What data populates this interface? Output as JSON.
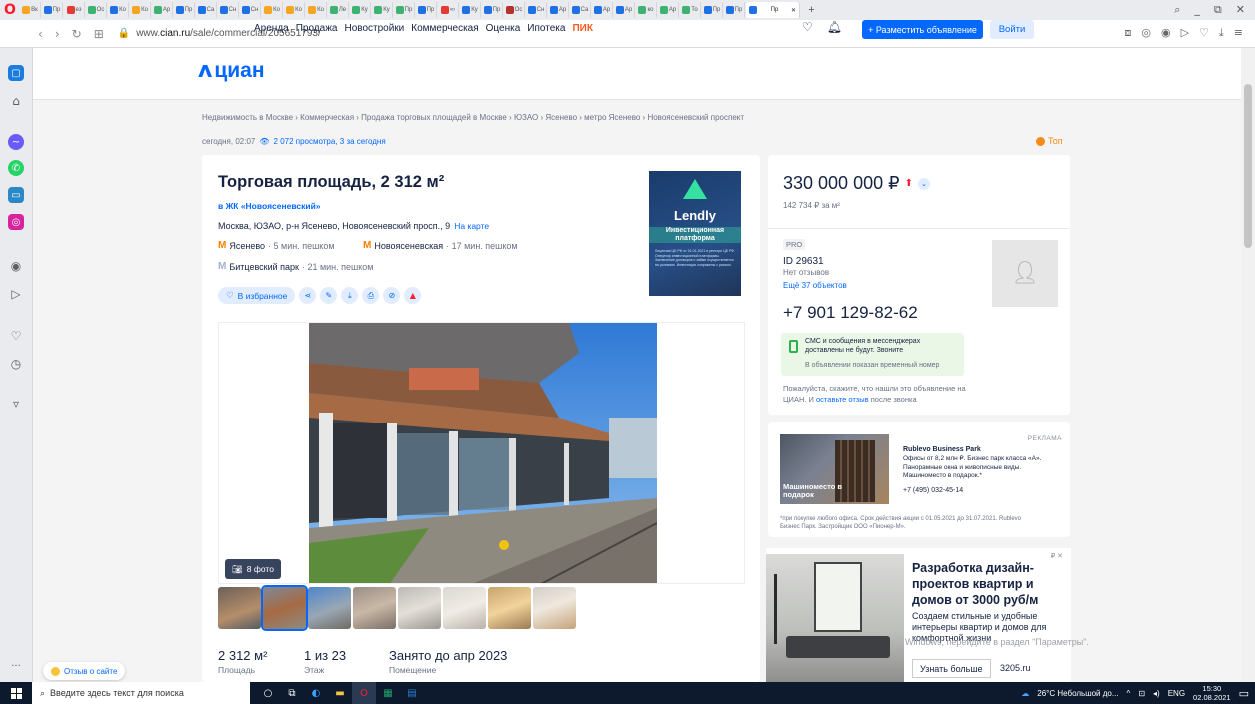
{
  "browser": {
    "url_prefix": "www.",
    "url_domain": "cian.ru",
    "url_path": "/sale/commercial/205651793/",
    "active_tab_label": "Пр",
    "tab_labels": [
      "Вк",
      "Пр",
      "ез",
      "Ос",
      "Ко",
      "Ко",
      "Ар",
      "Пр",
      "Са",
      "Сн",
      "Сн",
      "Ко",
      "Ко",
      "Ко",
      "Ле",
      "Ку",
      "Ку",
      "Пр",
      "Пр",
      "«›",
      "Ку",
      "Пр",
      "Ос",
      "Сн",
      "Ар",
      "Са",
      "Ар",
      "Ар",
      "ко",
      "Ар",
      "То",
      "Пр",
      "Пр"
    ],
    "tab_colors": [
      "#f5a623",
      "#1f6fe5",
      "#e53935",
      "#3cb371",
      "#1f6fe5",
      "#f5a623",
      "#3cb371",
      "#1f6fe5",
      "#1f6fe5",
      "#1f6fe5",
      "#1f6fe5",
      "#f5a623",
      "#f5a623",
      "#f5a623",
      "#3cb371",
      "#3cb371",
      "#3cb371",
      "#3cb371",
      "#1f6fe5",
      "#e53935",
      "#1f6fe5",
      "#1f6fe5",
      "#b7312c",
      "#1f6fe5",
      "#1f6fe5",
      "#1f6fe5",
      "#1f6fe5",
      "#1f6fe5",
      "#3cb371",
      "#3cb371",
      "#3cb371",
      "#1f6fe5",
      "#1f6fe5"
    ]
  },
  "site": {
    "logo": "циан",
    "nav": [
      "Аренда",
      "Продажа",
      "Новостройки",
      "Коммерческая",
      "Оценка",
      "Ипотека"
    ],
    "nav_pik": "ПИК",
    "post_button": "+ Разместить объявление",
    "login_button": "Войти"
  },
  "breadcrumbs": "Недвижимость в Москве  ›  Коммерческая  ›  Продажа торговых площадей в Москве  ›  ЮЗАО  ›  Ясенево  ›  метро Ясенево  ›  Новоясеневский проспект",
  "meta": {
    "date": "сегодня, 02:07",
    "views": "2 072 просмотра, 3 за сегодня",
    "top": "Топ"
  },
  "listing": {
    "title": "Торговая площадь, 2 312 м²",
    "complex": "в ЖК «Новоясеневский»",
    "address": "Москва, ЮЗАО, р-н Ясенево, Новоясеневский просп., 9",
    "map_link": "На карте",
    "metro": [
      {
        "name": "Ясенево",
        "walk": "· 5 мин. пешком"
      },
      {
        "name": "Новоясеневская",
        "walk": "· 17 мин. пешком"
      },
      {
        "name": "Битцевский парк",
        "walk": "· 21 мин. пешком"
      }
    ],
    "favorite_button": "В избранное",
    "photo_count": "8 фото",
    "facts": [
      {
        "value": "2 312 м²",
        "label": "Площадь"
      },
      {
        "value": "1 из 23",
        "label": "Этаж"
      },
      {
        "value": "Занято до апр 2023",
        "label": "Помещение"
      }
    ]
  },
  "ad_lendly": {
    "name": "Lendly",
    "tagline": "Инвестиционная платформа",
    "fine": "Лицензия ЦБ РФ от 01.01.2021 в реестре ЦБ РФ. Оператор инвестиционной платформы. Заключение договоров о займе осуществляется на условиях. Инвестиции сопряжены с риском."
  },
  "offer": {
    "price": "330 000 000 ₽",
    "per_sqm": "142 734 ₽ за м²",
    "pro": "PRO",
    "agent_id": "ID 29631",
    "reviews": "Нет отзывов",
    "more_objects": "Ещё 37 объектов",
    "phone": "+7 901 129-82-62",
    "sms_note": "СМС и сообщения в мессенджерах доставлены не будут. Звоните",
    "temp_number": "В объявлении показан временный номер",
    "ask_note": "Пожалуйста, скажите, что нашли это объявление на ЦИАН. И",
    "ask_link": "оставьте отзыв",
    "ask_tail": "после звонка"
  },
  "ad_rublevo": {
    "label": "РЕКЛАМА",
    "caption": "Машиноместо в подарок",
    "name": "Rublevo Business Park",
    "desc": "Офисы от 8,2 млн ₽. Бизнес парк класса «А». Панорамные окна и живописные виды. Машиноместо в подарок.*",
    "phone": "+7 (495) 032-45-14",
    "fine": "*при покупке любого офиса. Срок действия акции с 01.05.2021 до 31.07.2021. Rublevo Бизнес Парк. Застройщик ООО «Пионер-М»."
  },
  "ad_design": {
    "close": "₽ ✕",
    "headline": "Разработка дизайн-проектов квартир и домов от 3000 руб/м",
    "desc": "Создаем стильные и удобные интерьеры квартир и домов для комфортной жизни",
    "button": "Узнать больше",
    "domain": "3205.ru"
  },
  "watermark": "Windows, перейдите в раздел \"Параметры\".",
  "feedback": "Отзыв о сайте",
  "taskbar": {
    "search_placeholder": "Введите здесь текст для поиска",
    "weather": "26°C  Небольшой до...",
    "lang": "ENG",
    "time": "15:30",
    "date": "02.08.2021"
  }
}
